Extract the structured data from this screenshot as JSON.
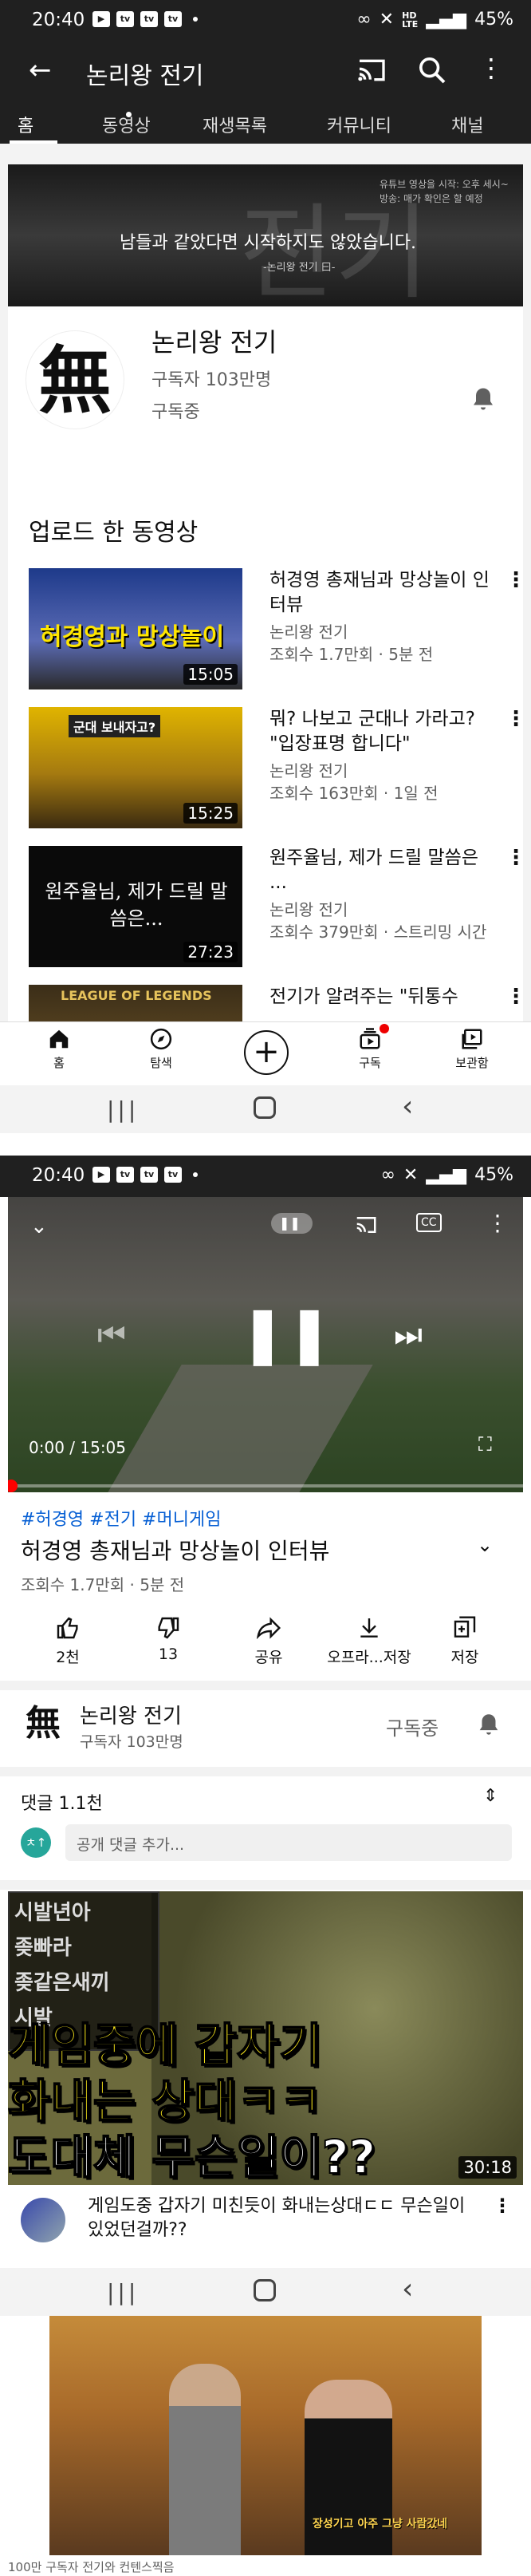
{
  "screen1": {
    "status": {
      "time": "20:40",
      "battery": "45%",
      "net1": "HD",
      "net2": "LTE"
    },
    "header": {
      "title": "논리왕 전기"
    },
    "tabs": [
      "홈",
      "동영상",
      "재생목록",
      "커뮤니티",
      "채널"
    ],
    "banner": {
      "motto": "남들과 같았다면 시작하지도 않았습니다.",
      "sign": "-논리왕 전기 曰-",
      "info1": "유튜브 영상을 시작: 오후 세시~",
      "info2": "방송: 매가 확인은 할 예정"
    },
    "channel": {
      "avatar_char": "無",
      "name": "논리왕 전기",
      "subs": "구독자 103만명",
      "subscribed": "구독중"
    },
    "uploads": {
      "heading": "업로드 한 동영상",
      "videos": [
        {
          "title": "허경영 총재님과 망상놀이 인터뷰",
          "channel": "논리왕 전기",
          "meta": "조회수 1.7만회 · 5분 전",
          "duration": "15:05",
          "thumb_text": "허경영과 망상놀이"
        },
        {
          "title": "뭐? 나보고 군대나 가라고? \"입장표명 합니다\"",
          "channel": "논리왕 전기",
          "meta": "조회수 163만회 · 1일 전",
          "duration": "15:25",
          "thumb_text": "군대 보내자고?"
        },
        {
          "title": "원주율님, 제가 드릴 말씀은 ...",
          "channel": "논리왕 전기",
          "meta": "조회수 379만회 · 스트리밍 시간",
          "duration": "27:23",
          "thumb_text": "원주율님, 제가 드릴 말씀은..."
        },
        {
          "title": "전기가 알려주는 \"뒤통수",
          "channel": "",
          "meta": "",
          "duration": "",
          "thumb_text": "LEAGUE OF LEGENDS"
        }
      ]
    },
    "bottom_nav": [
      {
        "label": "홈"
      },
      {
        "label": "탐색"
      },
      {
        "label": ""
      },
      {
        "label": "구독"
      },
      {
        "label": "보관함"
      }
    ]
  },
  "screen2": {
    "status": {
      "time": "20:40",
      "battery": "45%"
    },
    "player": {
      "time": "0:00 / 15:05",
      "progress": 0
    },
    "video": {
      "tags": "#허경영 #전기 #머니게임",
      "title": "허경영 총재님과 망상놀이 인터뷰",
      "meta": "조회수 1.7만회 · 5분 전"
    },
    "actions": [
      {
        "label": "2천",
        "icon": "thumbs-up-icon"
      },
      {
        "label": "13",
        "icon": "thumbs-down-icon"
      },
      {
        "label": "공유",
        "icon": "share-icon"
      },
      {
        "label": "오프라...저장",
        "icon": "download-icon"
      },
      {
        "label": "저장",
        "icon": "playlist-add-icon"
      }
    ],
    "channel": {
      "avatar_char": "無",
      "name": "논리왕 전기",
      "subs": "구독자 103만명",
      "subscribed": "구독중"
    },
    "comments": {
      "label": "댓글 1.1천",
      "avatar": "ㅊ↑",
      "placeholder": "공개 댓글 추가..."
    },
    "recommended": {
      "duration": "30:18",
      "thumb_lines": [
        "게임중에 갑자기",
        "화내는 상대ㅋㅋ",
        "도대체 무슨일이??"
      ],
      "panel_lines": [
        "시발년아",
        "좆빠라",
        "좆같은새끼",
        "시발"
      ],
      "title": "게임도중 갑자기 미친듯이 화내는상대ㄷㄷ 무슨일이 있었던걸까??"
    }
  },
  "screen3": {
    "caption": "장성기고 아주 그냥 사람갔네",
    "footer": "100만 구독자 전기와 컨텐스찍음"
  }
}
